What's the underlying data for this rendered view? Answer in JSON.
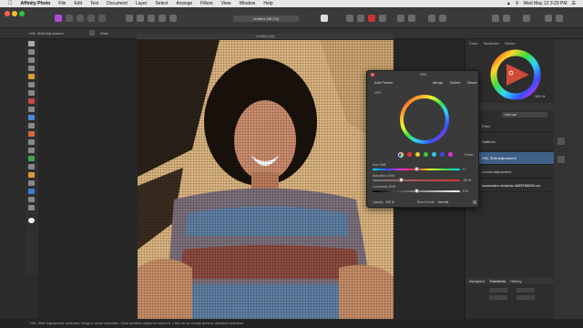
{
  "menubar": {
    "app_name": "Affinity Photo",
    "items": [
      "File",
      "Edit",
      "Text",
      "Document",
      "Layer",
      "Select",
      "Arrange",
      "Filters",
      "View",
      "Window",
      "Help"
    ],
    "datetime": "Wed May 12  3:29 PM"
  },
  "toolbar": {
    "zoom_label": "Untitled (88.2%)"
  },
  "contextbar": {
    "layer_label": "HSL Shift Adjustment",
    "mode_label": "Wide"
  },
  "document": {
    "tab_title": "Untitled (M)"
  },
  "hsl_dialog": {
    "title": "HSL",
    "add_preset": "Add Preset",
    "merge": "Merge",
    "delete": "Delete",
    "reset": "Reset",
    "hsv_label": "HSV",
    "picker_label": "Picker",
    "hue_shift_label": "Hue Shift",
    "hue_shift_value": "0 °",
    "saturation_label": "Saturation Shift",
    "saturation_value": "-32 %",
    "luminosity_label": "Luminosity Shift",
    "luminosity_value": "0 %",
    "opacity_label": "Opacity",
    "opacity_value": "100 %",
    "blend_mode_label": "Blend Mode",
    "blend_mode_value": "Normal"
  },
  "color_panel": {
    "tabs": [
      "Color",
      "Swatches",
      "Stroke"
    ]
  },
  "layers_panel": {
    "opacity_value": "100 %",
    "blend_value": "Normal",
    "items": [
      {
        "name": "Pixel"
      },
      {
        "name": "Halftone"
      },
      {
        "name": "HSL Shift Adjustment"
      },
      {
        "name": "Levels Adjustment"
      },
      {
        "name": "museums-victoria-1825783652-un"
      }
    ]
  },
  "transform_panel": {
    "tabs": [
      "Navigator",
      "Transform",
      "History"
    ]
  },
  "statusbar": {
    "text": "'HSL Shift Adjustment' selected. Drag to move selection. Click another object to select it. Click on an empty area to deselect selection."
  }
}
